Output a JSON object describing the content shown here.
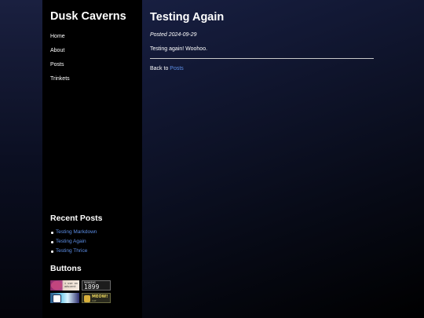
{
  "site": {
    "title": "Dusk Caverns"
  },
  "nav": {
    "items": [
      {
        "label": "Home"
      },
      {
        "label": "About"
      },
      {
        "label": "Posts"
      },
      {
        "label": "Trinkets"
      }
    ]
  },
  "recent_posts": {
    "heading": "Recent Posts",
    "items": [
      {
        "label": "Testing Markdown"
      },
      {
        "label": "Testing Again"
      },
      {
        "label": "Testing Thrice"
      }
    ]
  },
  "buttons": {
    "heading": "Buttons",
    "badges": [
      {
        "text": "i use an adscent"
      },
      {
        "text": "SINCE 1899",
        "small": "RUNNING",
        "big": "1899"
      },
      {
        "text": ""
      },
      {
        "text": "MEOW!",
        "small": "CAT"
      }
    ]
  },
  "post": {
    "title": "Testing Again",
    "date_label": "Posted 2024-09-29",
    "body": "Testing again! Woohoo.",
    "back_prefix": "Back to ",
    "back_link": "Posts"
  },
  "colors": {
    "link": "#5c8ee6",
    "sidebar_bg": "#000000",
    "page_bg": "#121834"
  }
}
